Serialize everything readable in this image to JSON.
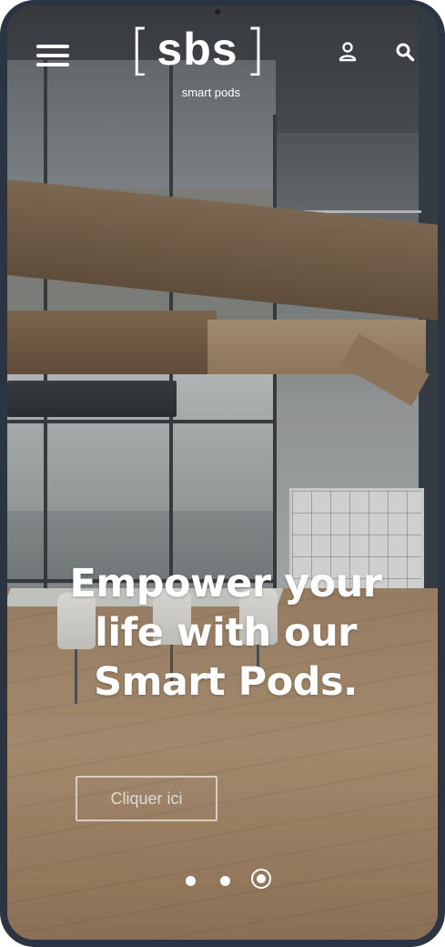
{
  "header": {
    "logo": {
      "brand": "sbs",
      "tagline": "smart pods"
    },
    "icons": [
      "menu-icon",
      "user-icon",
      "search-icon"
    ]
  },
  "hero": {
    "headline": "Empower your life with our Smart Pods.",
    "cta_label": "Cliquer ici",
    "slides": {
      "count": 3,
      "active": 3
    }
  },
  "colors": {
    "frame": "#2b3442",
    "text": "#ffffff"
  }
}
